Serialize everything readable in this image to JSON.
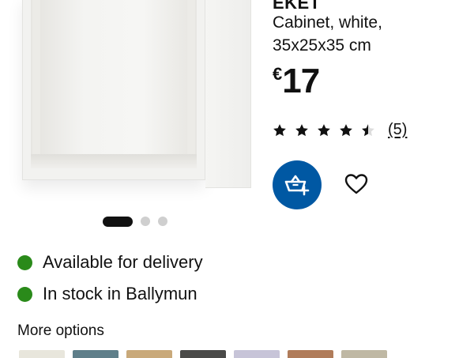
{
  "product": {
    "name": "EKET",
    "description_line1": "Cabinet, white,",
    "description_line2": "35x25x35 cm",
    "price_currency": "€",
    "price_amount": "17"
  },
  "rating": {
    "value": 4.5,
    "max": 5,
    "review_count": "(5)"
  },
  "carousel": {
    "slides": 3,
    "active_index": 0
  },
  "actions": {
    "cart_icon": "add-to-cart-icon",
    "favourite_icon": "heart-icon"
  },
  "availability": [
    {
      "text": "Available for delivery",
      "status_color": "#2a8a1a"
    },
    {
      "text": "In stock in Ballymun",
      "status_color": "#2a8a1a"
    }
  ],
  "more_options": {
    "title": "More options",
    "swatch_colors": [
      "#e8e6dc",
      "#5f7f8a",
      "#c9a97a",
      "#4a4a48",
      "#c7c4d8",
      "#b07c5a",
      "#bfb8a4"
    ]
  },
  "colors": {
    "accent": "#0058a3",
    "text": "#111111",
    "dot_inactive": "#cfcfcf"
  }
}
